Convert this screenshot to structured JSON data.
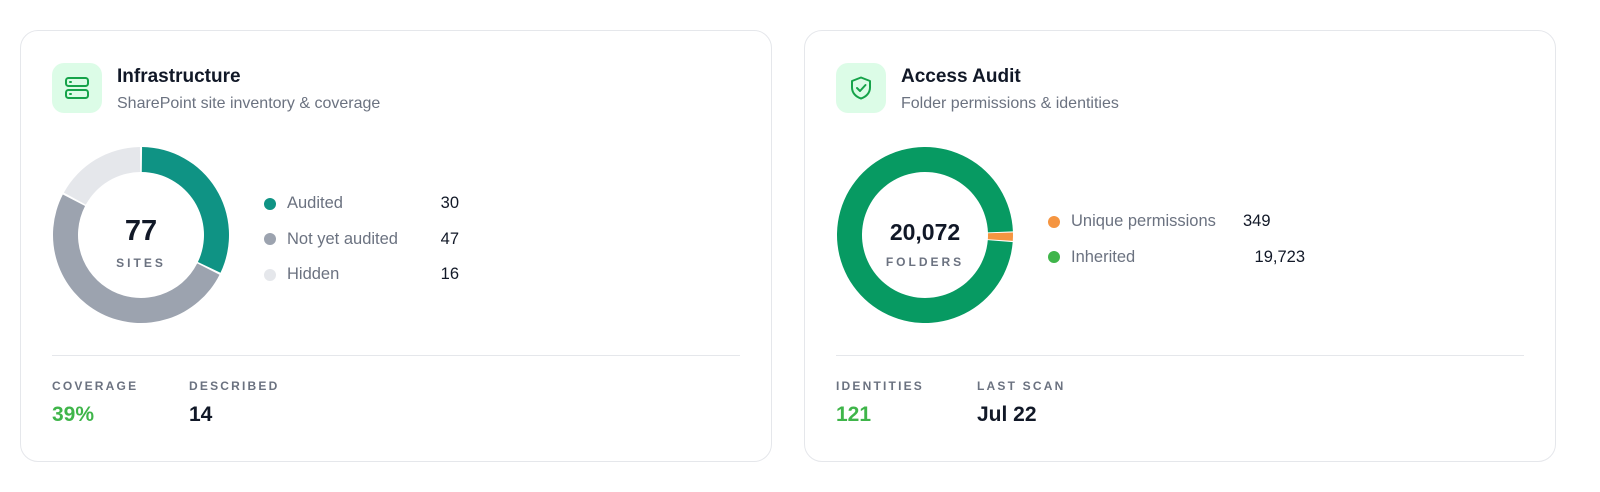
{
  "infrastructure": {
    "icon": "server-stack-icon",
    "title": "Infrastructure",
    "subtitle": "SharePoint site inventory & coverage",
    "donut": {
      "center_value": "77",
      "center_label": "SITES",
      "segments": [
        {
          "label": "Audited",
          "value": 30,
          "display": "30",
          "color": "#0f9384"
        },
        {
          "label": "Not yet audited",
          "value": 47,
          "display": "47",
          "color": "#9ca3af"
        },
        {
          "label": "Hidden",
          "value": 16,
          "display": "16",
          "color": "#e5e7eb"
        }
      ]
    },
    "stats": [
      {
        "label": "COVERAGE",
        "value": "39%",
        "color": "#3fb54a"
      },
      {
        "label": "DESCRIBED",
        "value": "14",
        "color": "#111827"
      }
    ]
  },
  "access_audit": {
    "icon": "shield-check-icon",
    "title": "Access Audit",
    "subtitle": "Folder permissions & identities",
    "donut": {
      "center_value": "20,072",
      "center_label": "FOLDERS",
      "segments": [
        {
          "label": "Unique permissions",
          "value": 349,
          "display": "349",
          "color": "#f59541"
        },
        {
          "label": "Inherited",
          "value": 19723,
          "display": "19,723",
          "color": "#079a62"
        }
      ]
    },
    "stats": [
      {
        "label": "IDENTITIES",
        "value": "121",
        "color": "#3fb54a"
      },
      {
        "label": "LAST SCAN",
        "value": "Jul 22",
        "color": "#111827"
      }
    ]
  }
}
